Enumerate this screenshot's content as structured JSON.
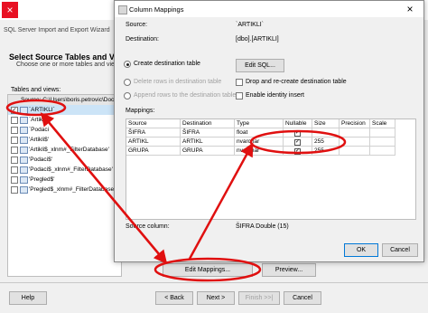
{
  "wizard": {
    "tab_title": "SQL Server Import and Export Wizard",
    "heading": "Select Source Tables and Views",
    "subheading": "Choose one or more tables and views to copy.",
    "tables_label": "Tables and views:",
    "source_header": "Source: C:\\Users\\boris.petrovic\\Doc...",
    "rows": [
      {
        "label": "`ARTIKLI`",
        "checked": true,
        "selected": true
      },
      {
        "label": "`Artikl",
        "checked": false
      },
      {
        "label": "`Podaci",
        "checked": false
      },
      {
        "label": "'Artikli$'",
        "checked": false
      },
      {
        "label": "'Artikli$_xlnm#_FilterDatabase'",
        "checked": false
      },
      {
        "label": "'Podaci$'",
        "checked": false
      },
      {
        "label": "'Podaci$_xlnm#_FilterDatabase'",
        "checked": false
      },
      {
        "label": "'Pregled$'",
        "checked": false
      },
      {
        "label": "'Pregled$_xlnm#_FilterDatabase'",
        "checked": false
      }
    ],
    "edit_mappings_label": "Edit Mappings...",
    "preview_label": "Preview...",
    "help_label": "Help",
    "back_label": "< Back",
    "next_label": "Next >",
    "finish_label": "Finish >>|",
    "cancel_label": "Cancel"
  },
  "dialog": {
    "title": "Column Mappings",
    "source_label": "Source:",
    "source_value": "`ARTIKLI`",
    "destination_label": "Destination:",
    "destination_value": "[dbo].[ARTIKLI]",
    "opt_create": "Create destination table",
    "edit_sql_label": "Edit SQL...",
    "opt_delete": "Delete rows in destination table",
    "drop_recreate": "Drop and re-create destination table",
    "opt_append": "Append rows to the destination table",
    "identity_insert": "Enable identity insert",
    "mappings_label": "Mappings:",
    "columns": [
      "Source",
      "Destination",
      "Type",
      "Nullable",
      "Size",
      "Precision",
      "Scale"
    ],
    "rows": [
      {
        "source": "ŠIFRA",
        "destination": "ŠIFRA",
        "type": "float",
        "nullable": true,
        "size": "",
        "precision": "",
        "scale": ""
      },
      {
        "source": "ARTIKL",
        "destination": "ARTIKL",
        "type": "nvarchar",
        "nullable": true,
        "size": "255",
        "precision": "",
        "scale": ""
      },
      {
        "source": "GRUPA",
        "destination": "GRUPA",
        "type": "nvarchar",
        "nullable": true,
        "size": "255",
        "precision": "",
        "scale": ""
      }
    ],
    "source_column_label": "Source column:",
    "source_column_value": "ŠIFRA Double (15)",
    "ok_label": "OK",
    "cancel_label": "Cancel",
    "close_icon": "×"
  },
  "colors": {
    "annotation": "#e01010",
    "accent": "#0078d7"
  }
}
